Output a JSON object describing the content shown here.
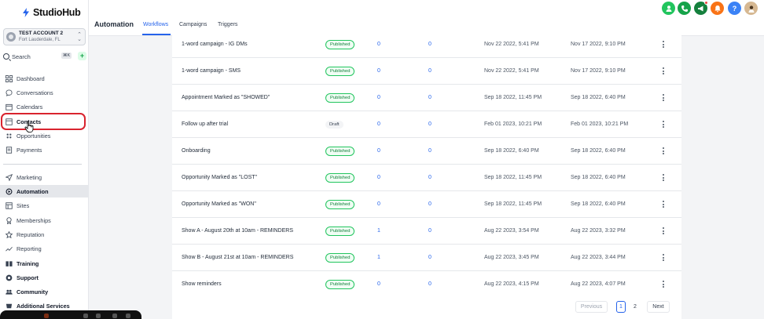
{
  "app": {
    "logo_text": "StudioHub"
  },
  "account": {
    "name": "TEST ACCOUNT 2",
    "location": "Fort Lauderdale, FL"
  },
  "search": {
    "label": "Search",
    "shortcut": "⌘K"
  },
  "sidebar": {
    "items": [
      {
        "label": "Dashboard",
        "icon": "dashboard-icon"
      },
      {
        "label": "Conversations",
        "icon": "chat-icon"
      },
      {
        "label": "Calendars",
        "icon": "calendar-icon"
      },
      {
        "label": "Contacts",
        "icon": "contacts-icon"
      },
      {
        "label": "Opportunities",
        "icon": "filter-icon"
      },
      {
        "label": "Payments",
        "icon": "receipt-icon"
      },
      {
        "label": "Marketing",
        "icon": "send-icon"
      },
      {
        "label": "Automation",
        "icon": "automation-icon"
      },
      {
        "label": "Sites",
        "icon": "sites-icon"
      },
      {
        "label": "Memberships",
        "icon": "award-icon"
      },
      {
        "label": "Reputation",
        "icon": "star-icon"
      },
      {
        "label": "Reporting",
        "icon": "trend-icon"
      },
      {
        "label": "Training",
        "icon": "book-icon"
      },
      {
        "label": "Support",
        "icon": "support-icon"
      },
      {
        "label": "Community",
        "icon": "people-icon"
      },
      {
        "label": "Additional Services",
        "icon": "services-icon"
      }
    ]
  },
  "header": {
    "title": "Automation",
    "tabs": [
      "Workflows",
      "Campaigns",
      "Triggers"
    ],
    "active_tab": "Workflows"
  },
  "colors": {
    "accent": "#2563eb",
    "published": "#22c55e",
    "highlight_ring": "#d9232e"
  },
  "workflows": {
    "rows": [
      {
        "name": "1-word campaign - IG DMs",
        "status": "Published",
        "n1": "0",
        "n2": "0",
        "created": "Nov 22 2022, 5:41 PM",
        "updated": "Nov 17 2022, 9:10 PM"
      },
      {
        "name": "1-word campaign - SMS",
        "status": "Published",
        "n1": "0",
        "n2": "0",
        "created": "Nov 22 2022, 5:41 PM",
        "updated": "Nov 17 2022, 9:10 PM"
      },
      {
        "name": "Appointment Marked as \"SHOWED\"",
        "status": "Published",
        "n1": "0",
        "n2": "0",
        "created": "Sep 18 2022, 11:45 PM",
        "updated": "Sep 18 2022, 6:40 PM"
      },
      {
        "name": "Follow up after trial",
        "status": "Draft",
        "n1": "0",
        "n2": "0",
        "created": "Feb 01 2023, 10:21 PM",
        "updated": "Feb 01 2023, 10:21 PM"
      },
      {
        "name": "Onboarding",
        "status": "Published",
        "n1": "0",
        "n2": "0",
        "created": "Sep 18 2022, 6:40 PM",
        "updated": "Sep 18 2022, 6:40 PM"
      },
      {
        "name": "Opportunity Marked as \"LOST\"",
        "status": "Published",
        "n1": "0",
        "n2": "0",
        "created": "Sep 18 2022, 11:45 PM",
        "updated": "Sep 18 2022, 6:40 PM"
      },
      {
        "name": "Opportunity Marked as \"WON\"",
        "status": "Published",
        "n1": "0",
        "n2": "0",
        "created": "Sep 18 2022, 11:45 PM",
        "updated": "Sep 18 2022, 6:40 PM"
      },
      {
        "name": "Show A - August 20th at 10am - REMINDERS",
        "status": "Published",
        "n1": "1",
        "n2": "0",
        "created": "Aug 22 2023, 3:54 PM",
        "updated": "Aug 22 2023, 3:32 PM"
      },
      {
        "name": "Show B - August 21st at 10am - REMINDERS",
        "status": "Published",
        "n1": "1",
        "n2": "0",
        "created": "Aug 22 2023, 3:45 PM",
        "updated": "Aug 22 2023, 3:44 PM"
      },
      {
        "name": "Show reminders",
        "status": "Published",
        "n1": "0",
        "n2": "0",
        "created": "Aug 22 2023, 4:15 PM",
        "updated": "Aug 22 2023, 4:07 PM"
      }
    ]
  },
  "pagination": {
    "prev": "Previous",
    "pages": [
      "1",
      "2"
    ],
    "current": "1",
    "next": "Next"
  }
}
